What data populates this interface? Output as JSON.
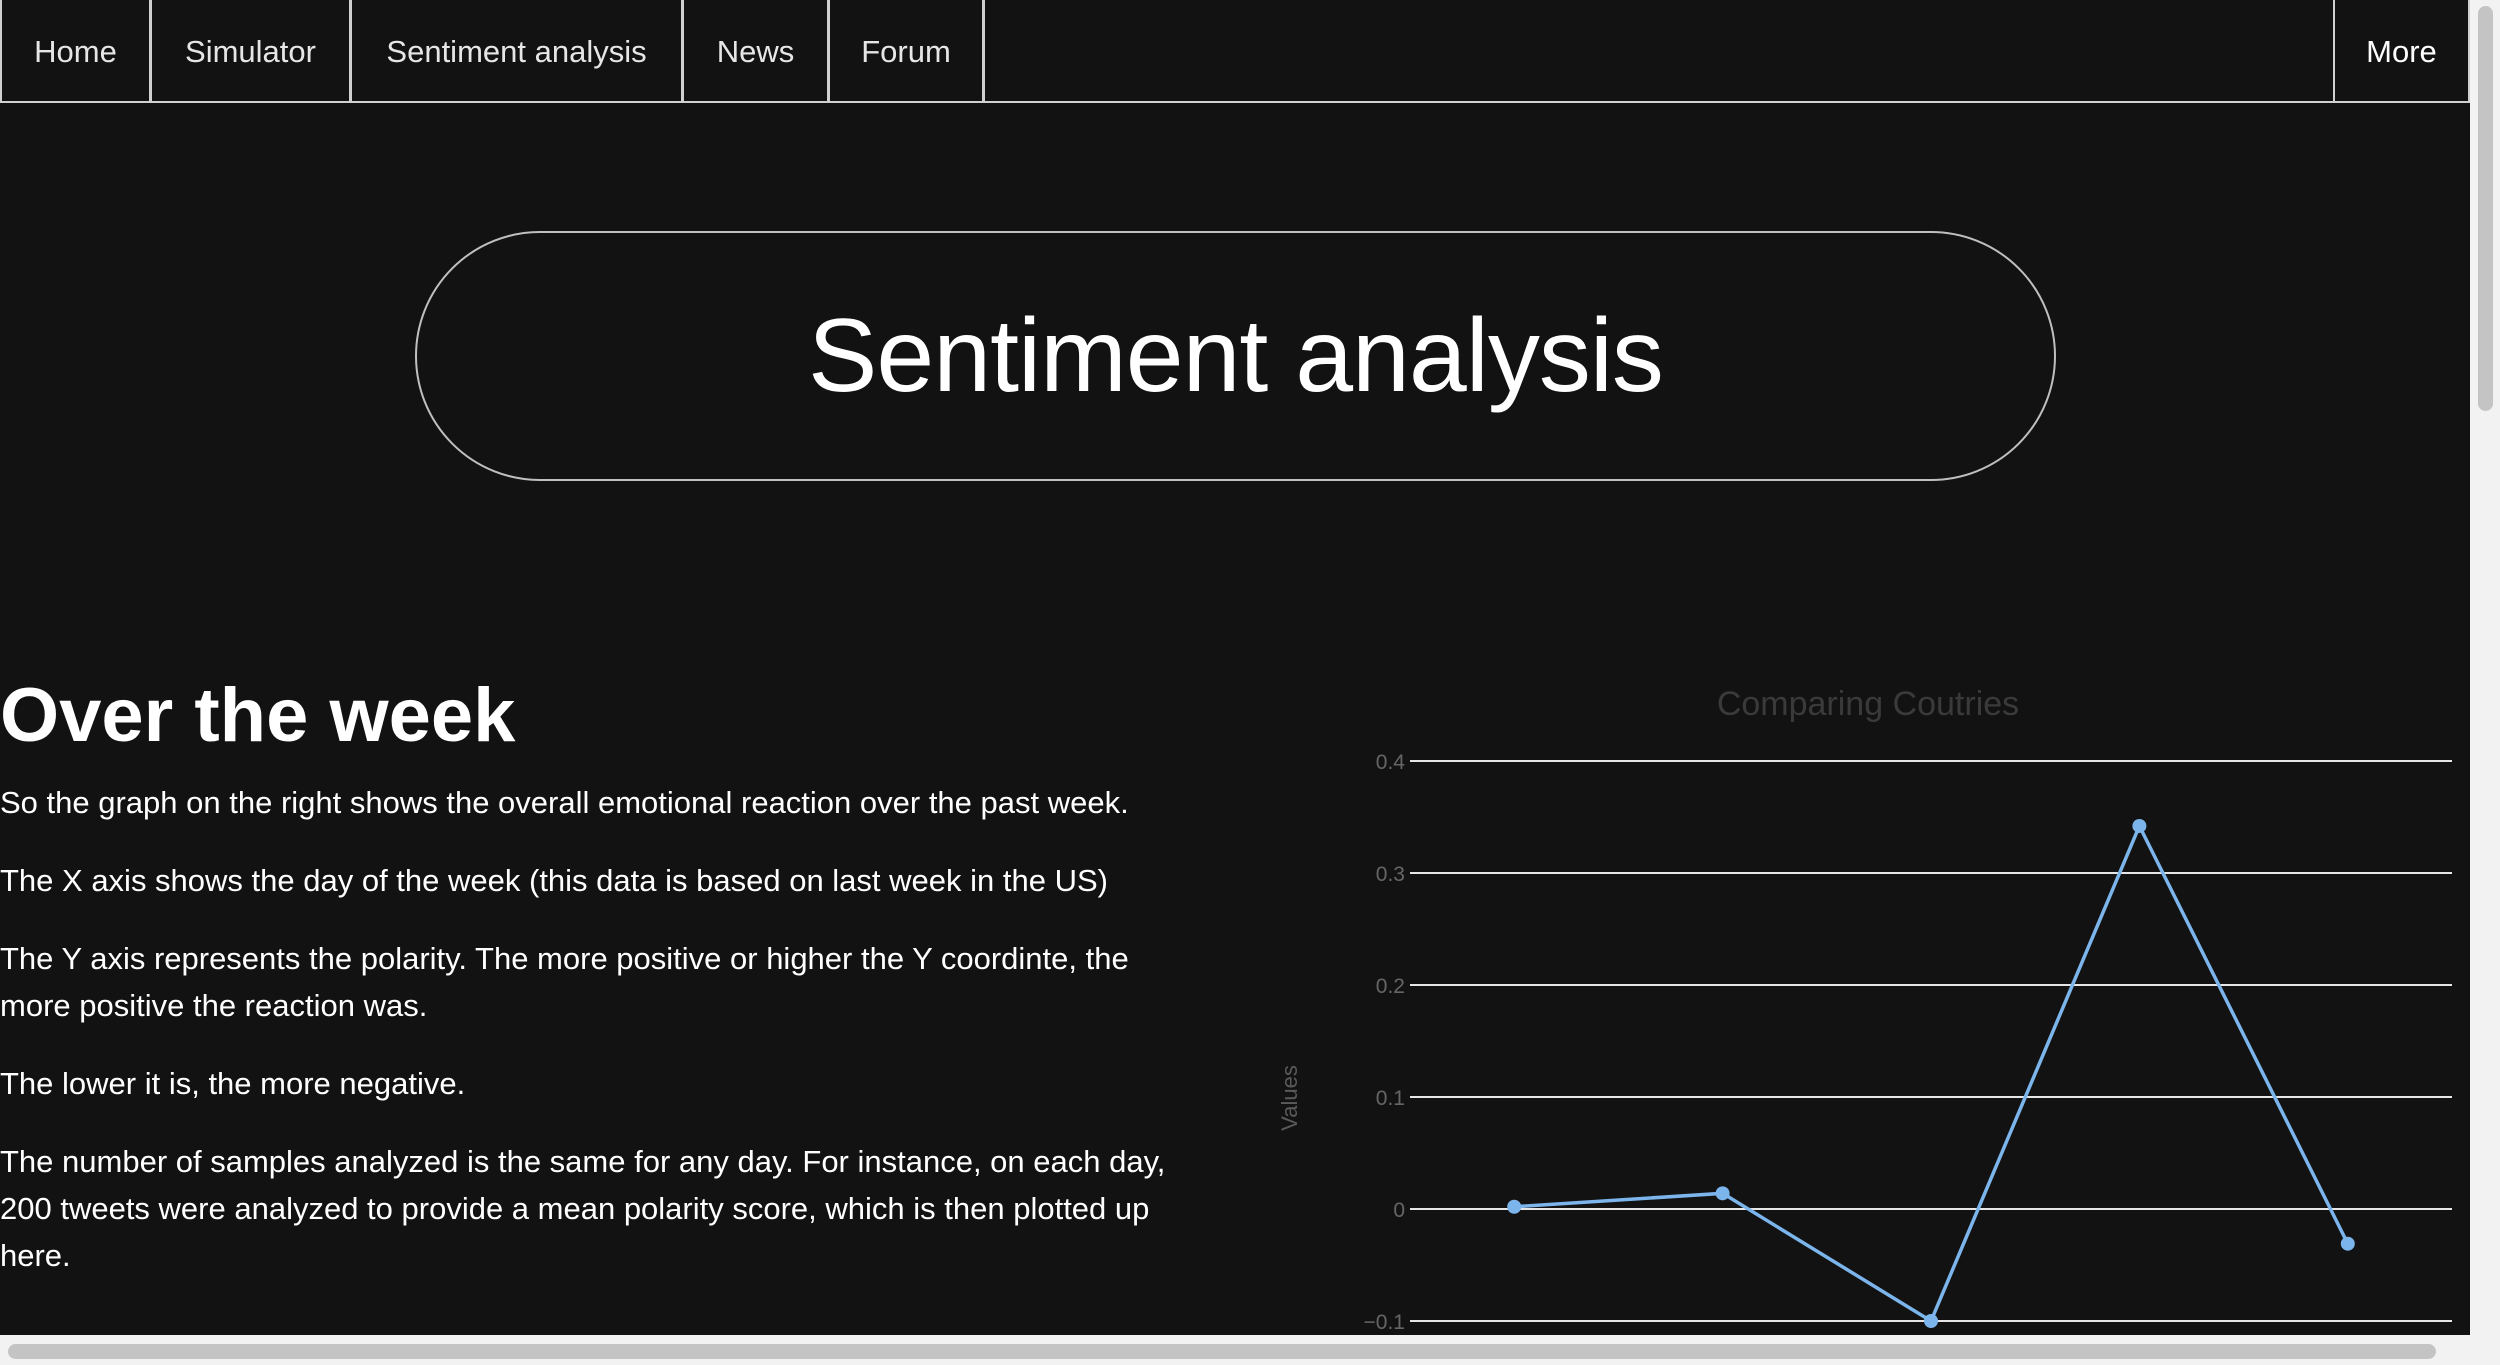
{
  "nav": {
    "items": [
      {
        "label": "Home"
      },
      {
        "label": "Simulator"
      },
      {
        "label": "Sentiment analysis"
      },
      {
        "label": "News"
      },
      {
        "label": "Forum"
      }
    ],
    "more_label": "More"
  },
  "hero": {
    "title": "Sentiment analysis"
  },
  "section": {
    "title": "Over the week",
    "paragraphs": [
      "So the graph on the right shows the overall emotional reaction over the past week.",
      "The X axis shows the day of the week (this data is based on last week in the US)",
      "The Y axis represents the polarity. The more positive or higher the Y coordinte, the more positive the reaction was.",
      "The lower it is, the more negative.",
      "The number of samples analyzed is the same for any day. For instance, on each day, 200 tweets were analyzed to provide a mean polarity score, which is then plotted up here."
    ]
  },
  "colors": {
    "background": "#121212",
    "line": "#7cb5ec",
    "grid": "#e6e6e6"
  },
  "chart_data": {
    "type": "line",
    "title": "Comparing Coutries",
    "ylabel": "Values",
    "xlabel": "",
    "ylim": [
      -0.1,
      0.4
    ],
    "yticks": [
      "0.4",
      "0.3",
      "0.2",
      "0.1",
      "0",
      "−0.1"
    ],
    "series": [
      {
        "values": [
          0.002,
          0.014,
          -0.1,
          0.342,
          -0.031
        ]
      }
    ],
    "grid": true,
    "legend": "none"
  }
}
